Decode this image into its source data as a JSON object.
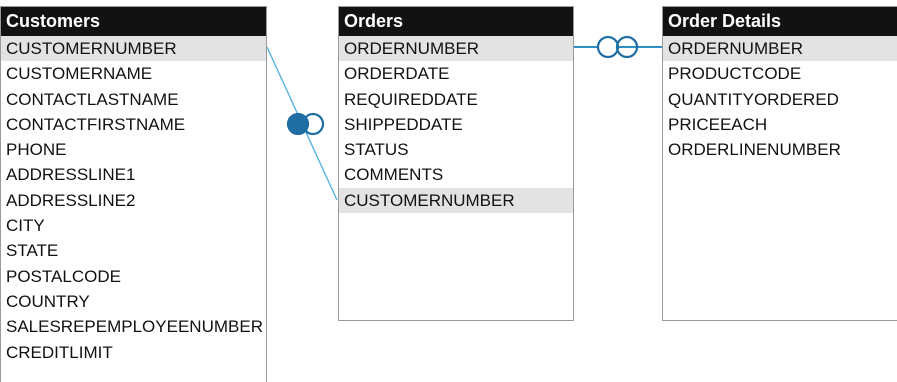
{
  "tables": [
    {
      "id": "customers",
      "title": "Customers",
      "fields": [
        {
          "name": "CUSTOMERNUMBER",
          "key": true
        },
        {
          "name": "CUSTOMERNAME",
          "key": false
        },
        {
          "name": "CONTACTLASTNAME",
          "key": false
        },
        {
          "name": "CONTACTFIRSTNAME",
          "key": false
        },
        {
          "name": "PHONE",
          "key": false
        },
        {
          "name": "ADDRESSLINE1",
          "key": false
        },
        {
          "name": "ADDRESSLINE2",
          "key": false
        },
        {
          "name": "CITY",
          "key": false
        },
        {
          "name": "STATE",
          "key": false
        },
        {
          "name": "POSTALCODE",
          "key": false
        },
        {
          "name": "COUNTRY",
          "key": false
        },
        {
          "name": "SALESREPEMPLOYEENUMBER",
          "key": false
        },
        {
          "name": "CREDITLIMIT",
          "key": false
        }
      ]
    },
    {
      "id": "orders",
      "title": "Orders",
      "fields": [
        {
          "name": "ORDERNUMBER",
          "key": true
        },
        {
          "name": "ORDERDATE",
          "key": false
        },
        {
          "name": "REQUIREDDATE",
          "key": false
        },
        {
          "name": "SHIPPEDDATE",
          "key": false
        },
        {
          "name": "STATUS",
          "key": false
        },
        {
          "name": "COMMENTS",
          "key": false
        },
        {
          "name": "CUSTOMERNUMBER",
          "key": true
        }
      ]
    },
    {
      "id": "order-details",
      "title": "Order Details",
      "fields": [
        {
          "name": "ORDERNUMBER",
          "key": true
        },
        {
          "name": "PRODUCTCODE",
          "key": false
        },
        {
          "name": "QUANTITYORDERED",
          "key": false
        },
        {
          "name": "PRICEEACH",
          "key": false
        },
        {
          "name": "ORDERLINENUMBER",
          "key": false
        }
      ]
    }
  ],
  "relationships": [
    {
      "from": "Customers.CUSTOMERNUMBER",
      "to": "Orders.CUSTOMERNUMBER",
      "symbol": "one-to-many-circles"
    },
    {
      "from": "Orders.ORDERNUMBER",
      "to": "Order Details.ORDERNUMBER",
      "symbol": "one-to-one-circles"
    }
  ],
  "colors": {
    "header_bg": "#121212",
    "header_text": "#ffffff",
    "key_row_bg": "#e3e3e3",
    "connector": "#2e8fc4",
    "connector_fill": "#1f6ea3"
  },
  "icons": {
    "relationship_marker_left": "half-filled-double-circle-icon",
    "relationship_marker_right": "double-circle-icon"
  }
}
